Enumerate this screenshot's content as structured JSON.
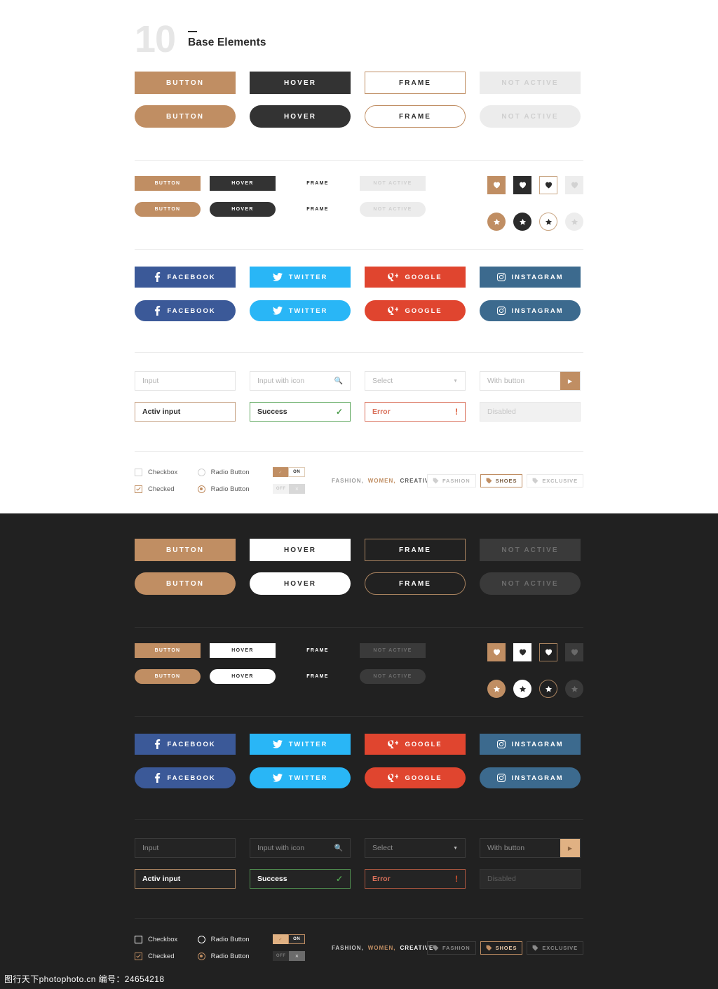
{
  "header": {
    "number": "10",
    "title": "Base Elements"
  },
  "buttons": {
    "primary": "BUTTON",
    "hover": "HOVER",
    "frame": "FRAME",
    "disabled": "NOT ACTIVE"
  },
  "social": [
    {
      "label": "FACEBOOK",
      "icon": "facebook-icon",
      "color": "#3b5998"
    },
    {
      "label": "TWITTER",
      "icon": "twitter-icon",
      "color": "#29b6f6"
    },
    {
      "label": "GOOGLE",
      "icon": "google-plus-icon",
      "color": "#e0452f"
    },
    {
      "label": "INSTAGRAM",
      "icon": "instagram-icon",
      "color": "#3c6a8e"
    }
  ],
  "inputs": {
    "row1": [
      {
        "name": "input",
        "value": "Input",
        "icon": ""
      },
      {
        "name": "input-with-icon",
        "value": "Input with icon",
        "icon": "search-icon"
      },
      {
        "name": "select",
        "value": "Select",
        "icon": "chevron-down-icon"
      },
      {
        "name": "input-with-button",
        "value": "With button",
        "icon": "arrow-right-icon"
      }
    ],
    "row2": [
      {
        "name": "active-input",
        "value": "Activ input",
        "icon": ""
      },
      {
        "name": "success-input",
        "value": "Success",
        "icon": "check-icon"
      },
      {
        "name": "error-input",
        "value": "Error",
        "icon": "exclamation-icon"
      },
      {
        "name": "disabled-input",
        "value": "Disabled",
        "icon": ""
      }
    ]
  },
  "controls": {
    "checkbox_label": "Checkbox",
    "checked_label": "Checked",
    "radio_label": "Radio Button",
    "toggle_on": "ON",
    "toggle_off": "OFF",
    "tagline": {
      "part1": "FASHION,",
      "part2": "WOMEN,",
      "part3": "CREATIVE"
    },
    "chips": [
      {
        "label": "FASHION",
        "active": false
      },
      {
        "label": "SHOES",
        "active": true
      },
      {
        "label": "EXCLUSIVE",
        "active": false
      }
    ]
  },
  "icons": {
    "heart": "heart-icon",
    "star": "star-icon"
  },
  "colors": {
    "tan": "#c08e63",
    "dark": "#212121",
    "charcoal": "#333333",
    "success": "#5fa85f",
    "error": "#d9705a"
  },
  "watermark": "图行天下photophoto.cn  编号：24654218"
}
